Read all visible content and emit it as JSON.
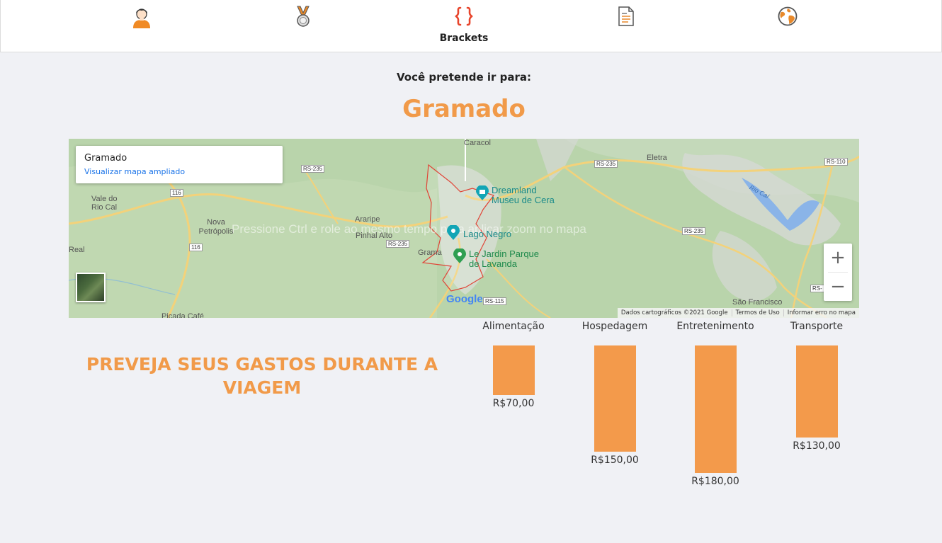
{
  "nav": {
    "items": [
      {
        "icon": "user-avatar-icon",
        "label": ""
      },
      {
        "icon": "medal-icon",
        "label": ""
      },
      {
        "icon": "brackets-icon",
        "label": "Brackets"
      },
      {
        "icon": "document-icon",
        "label": ""
      },
      {
        "icon": "globe-icon",
        "label": ""
      }
    ]
  },
  "intro": "Você pretende ir para:",
  "city": "Gramado",
  "map": {
    "card_title": "Gramado",
    "card_link": "Visualizar mapa ampliado",
    "hint": "Pressione Ctrl e role ao mesmo tempo para aplicar zoom no mapa",
    "zoom_in": "+",
    "zoom_out": "−",
    "attribution": {
      "data": "Dados cartográficos ©2021 Google",
      "terms": "Termos de Uso",
      "report": "Informar erro no mapa"
    },
    "labels": {
      "caracol": "Caracol",
      "eletra": "Eletra",
      "vale": "Vale do\nRio Cal",
      "nova": "Nova\nPetrópolis",
      "araripe": "Araripe",
      "pinhal": "Pinhal Alto",
      "real": "Real",
      "grama": "Grama",
      "picada": "Picada Café",
      "rio_cai": "Rio Caí",
      "sao_francisco": "São Francisco",
      "google": "Google"
    },
    "pois": {
      "dreamland": "Dreamland\nMuseu de Cera",
      "lago": "Lago Negro",
      "jardin": "Le Jardin Parque\nde Lavanda"
    },
    "roads": {
      "rs235a": "RS-235",
      "rs235b": "RS-235",
      "rs235c": "RS-235",
      "rs235d": "RS-235",
      "rs110": "RS-110",
      "r116a": "116",
      "r116b": "116",
      "rs115": "RS-115",
      "rs_edge": "RS-"
    }
  },
  "expenses": {
    "title": "PREVEJA SEUS GASTOS DURANTE A VIAGEM",
    "items": [
      {
        "category": "Alimentação",
        "value": 70,
        "label": "R$70,00"
      },
      {
        "category": "Hospedagem",
        "value": 150,
        "label": "R$150,00"
      },
      {
        "category": "Entretenimento",
        "value": 180,
        "label": "R$180,00"
      },
      {
        "category": "Transporte",
        "value": 130,
        "label": "R$130,00"
      }
    ]
  },
  "colors": {
    "accent": "#f19a49",
    "bar": "#f39a4b",
    "background": "#f0f1f5",
    "link": "#1a73e8"
  }
}
